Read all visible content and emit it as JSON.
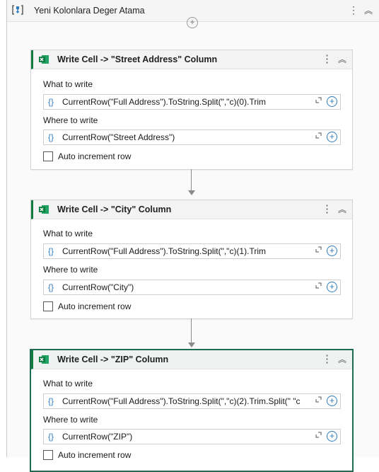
{
  "sequence": {
    "title": "Yeni Kolonlara Deger Atama",
    "icon": "sequence-icon"
  },
  "cards": [
    {
      "title": "Write Cell -> \"Street Address\" Column",
      "what_label": "What to write",
      "what_value": "CurrentRow(\"Full Address\").ToString.Split(\",\"c)(0).Trim",
      "where_label": "Where to write",
      "where_value": "CurrentRow(\"Street Address\")",
      "auto_label": "Auto increment row"
    },
    {
      "title": "Write Cell -> \"City\" Column",
      "what_label": "What to write",
      "what_value": "CurrentRow(\"Full Address\").ToString.Split(\",\"c)(1).Trim",
      "where_label": "Where to write",
      "where_value": "CurrentRow(\"City\")",
      "auto_label": "Auto increment row"
    },
    {
      "title": "Write Cell -> \"ZIP\" Column",
      "what_label": "What to write",
      "what_value": "CurrentRow(\"Full Address\").ToString.Split(\",\"c)(2).Trim.Split(\" \"c",
      "where_label": "Where to write",
      "where_value": "CurrentRow(\"ZIP\")",
      "auto_label": "Auto increment row"
    }
  ],
  "colors": {
    "excel_green": "#107c41",
    "selected_border": "#1e6b52",
    "accent_blue": "#2f7bbf"
  }
}
